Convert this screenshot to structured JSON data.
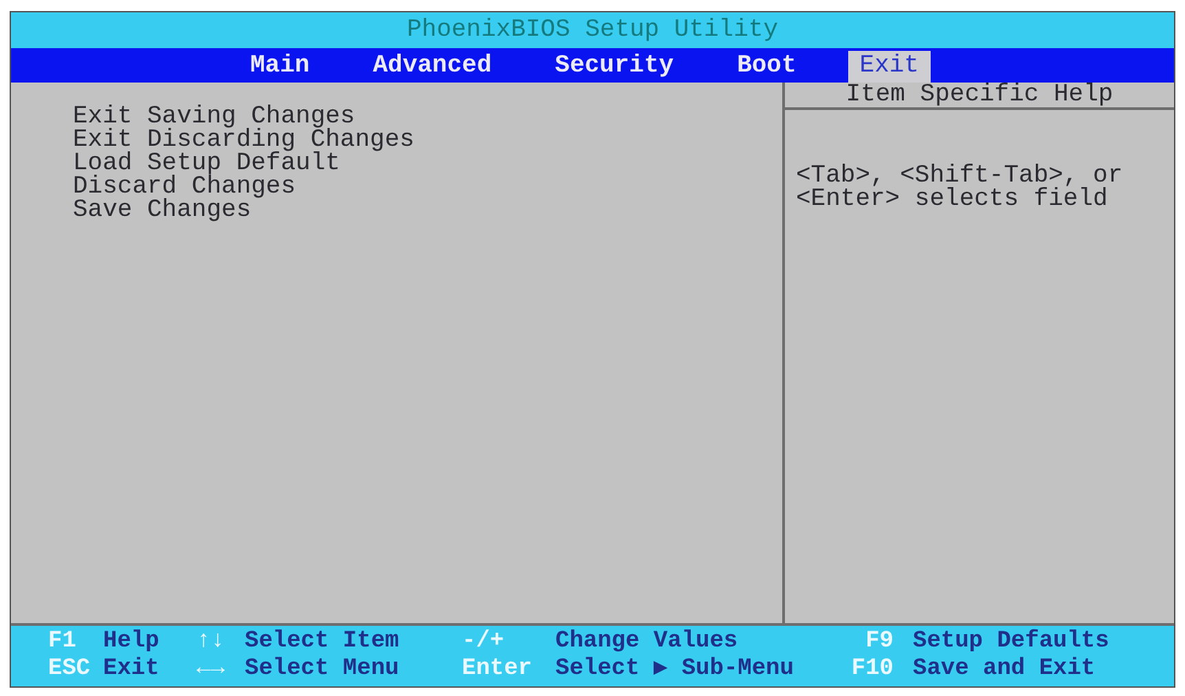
{
  "window": {
    "title": "PhoenixBIOS Setup Utility"
  },
  "tabs": [
    {
      "label": "Main",
      "selected": false
    },
    {
      "label": "Advanced",
      "selected": false
    },
    {
      "label": "Security",
      "selected": false
    },
    {
      "label": "Boot",
      "selected": false
    },
    {
      "label": "Exit",
      "selected": true
    }
  ],
  "menu_items": [
    "Exit Saving Changes",
    "Exit Discarding Changes",
    "Load Setup Default",
    "Discard Changes",
    "Save Changes"
  ],
  "help_panel": {
    "title": "Item Specific Help",
    "text": [
      "<Tab>, <Shift-Tab>, or",
      "<Enter> selects field"
    ]
  },
  "status_bar": [
    [
      {
        "key": "F1",
        "description": "Help"
      },
      {
        "key": "↑↓",
        "description": "Select Item"
      },
      {
        "key": "-/+",
        "description": "Change Values"
      },
      {
        "key": "F9",
        "description": "Setup Defaults"
      }
    ],
    [
      {
        "key": "ESC",
        "description": "Exit"
      },
      {
        "key": "←→",
        "description": "Select Menu"
      },
      {
        "key": "Enter",
        "description": "Select ▶ Sub-Menu"
      },
      {
        "key": "F10",
        "description": "Save and Exit"
      }
    ]
  ]
}
